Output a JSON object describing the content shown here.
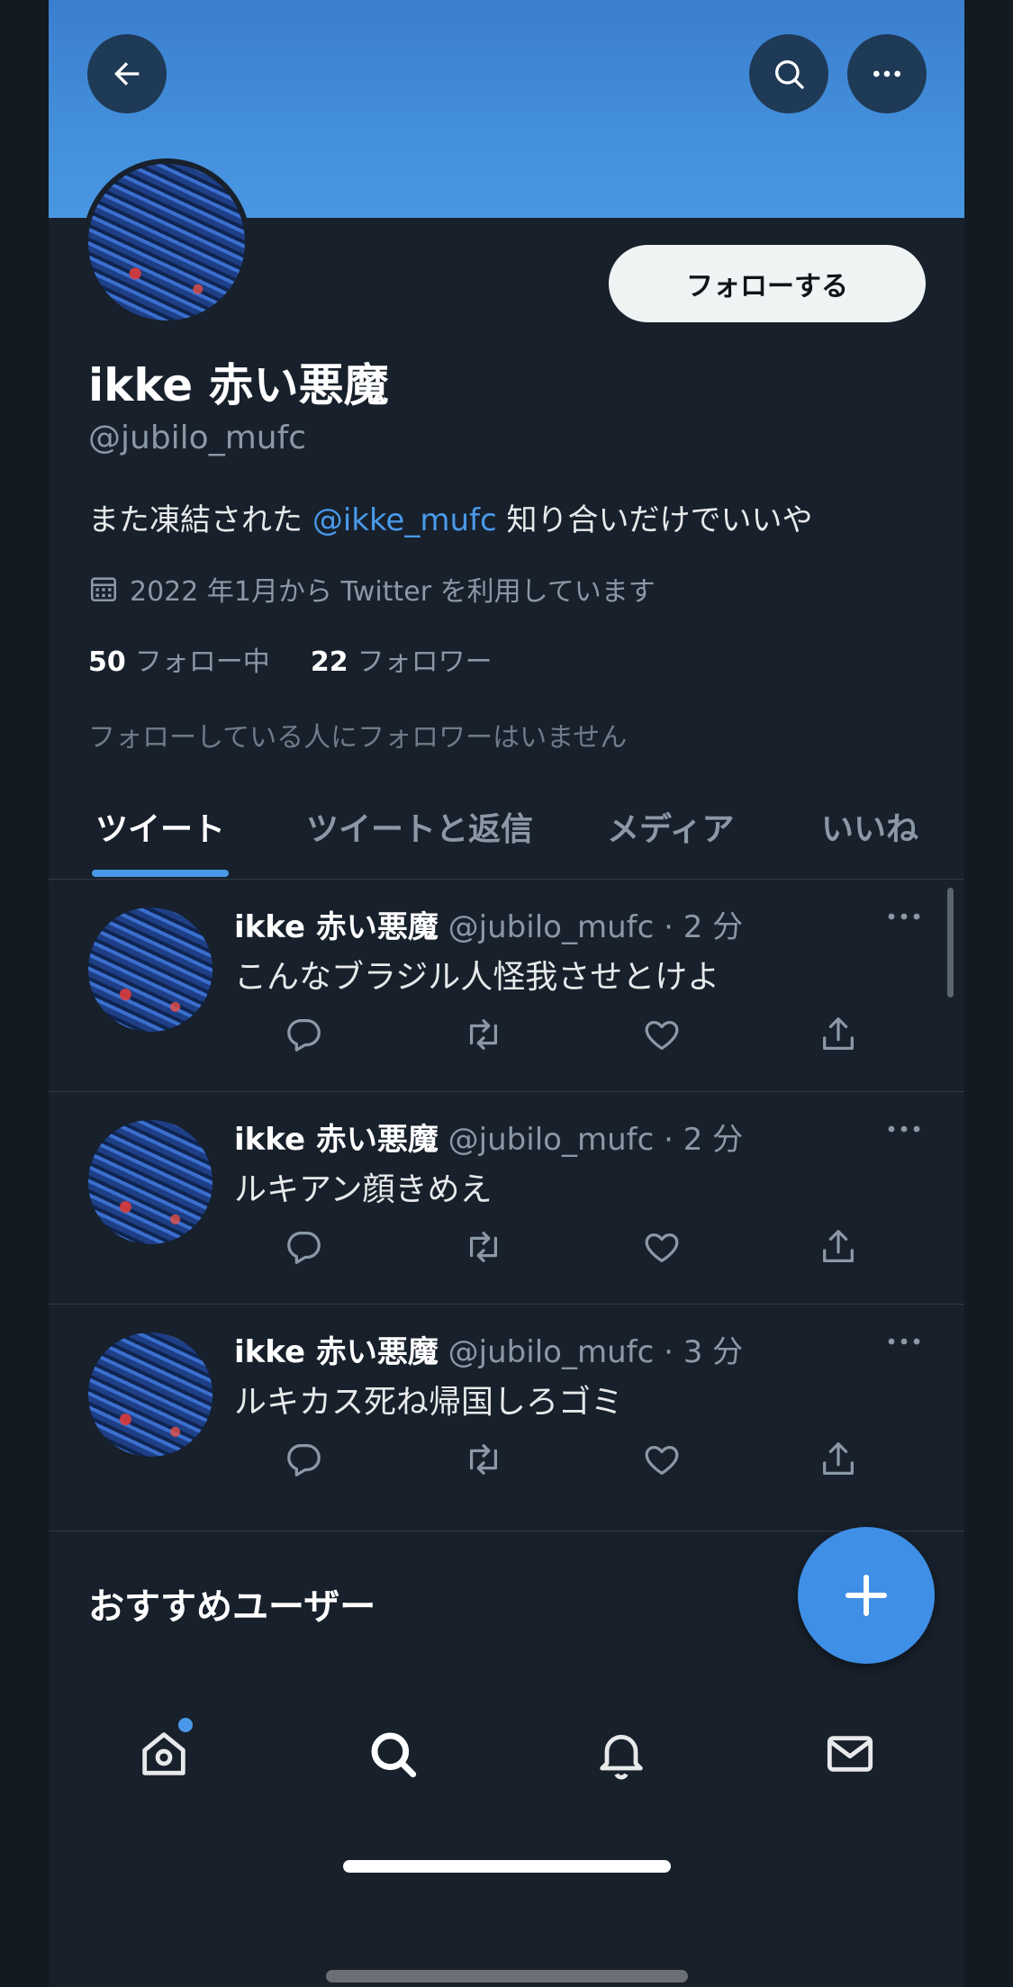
{
  "profile": {
    "display_name": "ikke 赤い悪魔",
    "handle": "@jubilo_mufc",
    "bio_prefix": "また凍結された ",
    "bio_mention": "@ikke_mufc",
    "bio_suffix": " 知り合いだけでいいや",
    "joined": "2022 年1月から Twitter を利用しています",
    "following_count": "50",
    "following_label": "フォロー中",
    "followers_count": "22",
    "followers_label": "フォロワー",
    "no_followers_note": "フォローしている人にフォロワーはいません",
    "follow_button": "フォローする"
  },
  "tabs": [
    {
      "label": "ツイート",
      "active": true
    },
    {
      "label": "ツイートと返信",
      "active": false
    },
    {
      "label": "メディア",
      "active": false
    },
    {
      "label": "いいね",
      "active": false
    }
  ],
  "tweets": [
    {
      "name": "ikke 赤い悪魔",
      "meta": " @jubilo_mufc · 2 分",
      "text": "こんなブラジル人怪我させとけよ"
    },
    {
      "name": "ikke 赤い悪魔",
      "meta": " @jubilo_mufc · 2 分",
      "text": "ルキアン顔きめえ"
    },
    {
      "name": "ikke 赤い悪魔",
      "meta": " @jubilo_mufc · 3 分",
      "text": "ルキカス死ね帰国しろゴミ"
    }
  ],
  "recommend_title": "おすすめユーザー",
  "icons": {
    "back": "arrow-left-icon",
    "search": "search-icon",
    "more": "more-horizontal-icon",
    "calendar": "calendar-icon",
    "reply": "reply-icon",
    "retweet": "retweet-icon",
    "like": "heart-icon",
    "share": "share-icon",
    "compose": "plus-icon",
    "home": "home-icon",
    "explore": "search-icon",
    "notifications": "bell-icon",
    "messages": "mail-icon"
  },
  "colors": {
    "background": "#17202b",
    "accent": "#4a99e9",
    "secondary_text": "#8b98a5"
  }
}
